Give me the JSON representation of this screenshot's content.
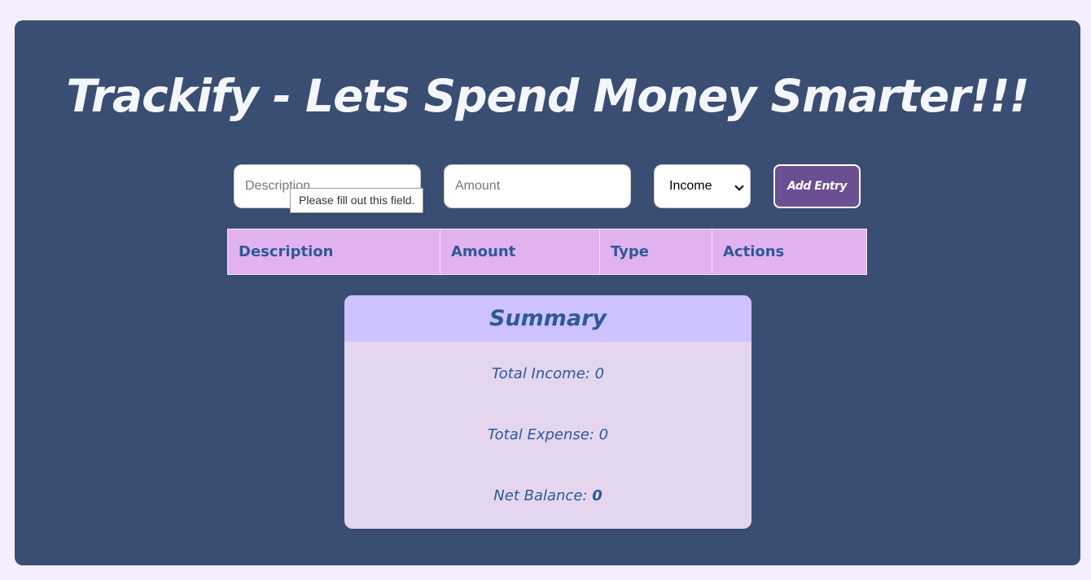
{
  "header": {
    "title": "Trackify - Lets Spend Money Smarter!!!"
  },
  "form": {
    "description_placeholder": "Description",
    "amount_placeholder": "Amount",
    "type_selected": "Income",
    "add_button_label": "Add Entry",
    "validation_tooltip": "Please fill out this field."
  },
  "table": {
    "headers": [
      "Description",
      "Amount",
      "Type",
      "Actions"
    ]
  },
  "summary": {
    "heading": "Summary",
    "income_label": "Total Income: ",
    "income_value": "0",
    "expense_label": "Total Expense: ",
    "expense_value": "0",
    "balance_label": "Net Balance: ",
    "balance_value": "0"
  },
  "colors": {
    "page_background": "#f5eeff",
    "panel_background": "#3a4d72",
    "table_header": "#e2b2f0",
    "summary_header": "#cdc2fe",
    "summary_body": "#e5d6ef",
    "button": "#6a4f93",
    "text_accent": "#2d5a95"
  }
}
